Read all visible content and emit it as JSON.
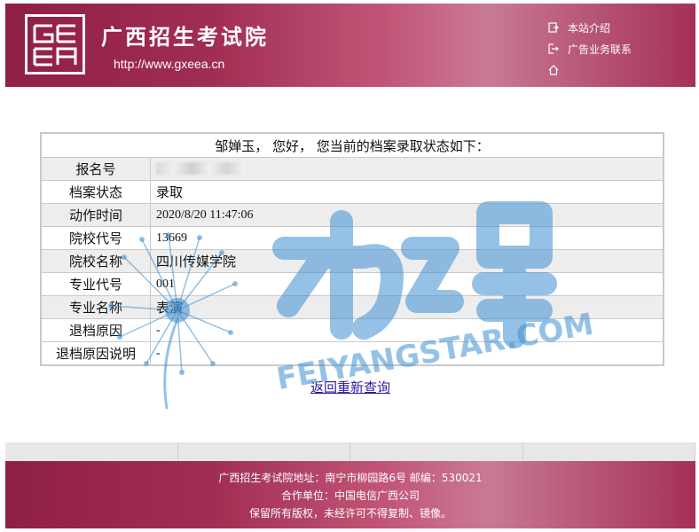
{
  "header": {
    "title": "广西招生考试院",
    "url": "http://www.gxeea.cn",
    "links": [
      {
        "label": "本站介绍",
        "icon": "page-arrow-icon"
      },
      {
        "label": "广告业务联系",
        "icon": "exit-arrow-icon"
      },
      {
        "label": "",
        "icon": "home-icon"
      }
    ]
  },
  "result": {
    "caption": "邹婵玉， 您好， 您当前的档案录取状态如下：",
    "rows": [
      {
        "label": "报名号",
        "value": ""
      },
      {
        "label": "档案状态",
        "value": "录取"
      },
      {
        "label": "动作时间",
        "value": "2020/8/20 11:47:06"
      },
      {
        "label": "院校代号",
        "value": "13669"
      },
      {
        "label": "院校名称",
        "value": "四川传媒学院"
      },
      {
        "label": "专业代号",
        "value": "001"
      },
      {
        "label": "专业名称",
        "value": "表演"
      },
      {
        "label": "退档原因",
        "value": "-"
      },
      {
        "label": "退档原因说明",
        "value": "-"
      }
    ],
    "back_link": "返回重新查询"
  },
  "watermark": {
    "text": "FEIYANGSTAR.COM",
    "color": "#3d8fd1"
  },
  "footer": {
    "line1": "广西招生考试院地址：南宁市柳园路6号    邮编：530021",
    "line2": "合作单位：中国电信广西公司",
    "line3": "保留所有版权，未经许可不得复制、镜像。"
  },
  "colors": {
    "brand": "#a02e52",
    "row_shade": "#ededed",
    "link": "#2c1a9c"
  }
}
